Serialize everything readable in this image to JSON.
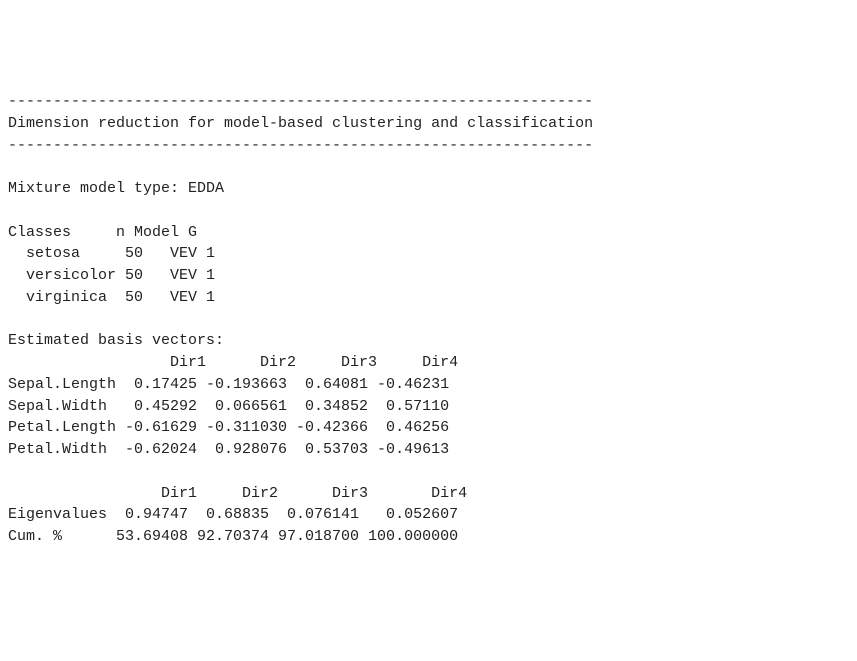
{
  "sep_line": "-----------------------------------------------------------------",
  "title": "Dimension reduction for model-based clustering and classification",
  "mixture_label": "Mixture model type:",
  "mixture_type": "EDDA",
  "classes_header": "Classes     n Model G",
  "classes": [
    {
      "name": "setosa",
      "n": 50,
      "model": "VEV",
      "g": 1
    },
    {
      "name": "versicolor",
      "n": 50,
      "model": "VEV",
      "g": 1
    },
    {
      "name": "virginica",
      "n": 50,
      "model": "VEV",
      "g": 1
    }
  ],
  "basis_label": "Estimated basis vectors:",
  "dir_header": "                  Dir1      Dir2     Dir3     Dir4",
  "basis": [
    {
      "var": "Sepal.Length",
      "d1": "0.17425",
      "d2": "-0.193663",
      "d3": "0.64081",
      "d4": "-0.46231"
    },
    {
      "var": "Sepal.Width",
      "d1": "0.45292",
      "d2": "0.066561",
      "d3": "0.34852",
      "d4": "0.57110"
    },
    {
      "var": "Petal.Length",
      "d1": "-0.61629",
      "d2": "-0.311030",
      "d3": "-0.42366",
      "d4": "0.46256"
    },
    {
      "var": "Petal.Width",
      "d1": "-0.62024",
      "d2": "0.928076",
      "d3": "0.53703",
      "d4": "-0.49613"
    }
  ],
  "stats_header": "                 Dir1     Dir2      Dir3       Dir4",
  "stats": [
    {
      "label": "Eigenvalues",
      "d1": "0.94747",
      "d2": "0.68835",
      "d3": "0.076141",
      "d4": "0.052607"
    },
    {
      "label": "Cum. %",
      "d1": "53.69408",
      "d2": "92.70374",
      "d3": "97.018700",
      "d4": "100.000000"
    }
  ],
  "chart_data": {
    "type": "table",
    "title": "Dimension reduction for model-based clustering and classification",
    "subtitle": "Mixture model type: EDDA",
    "classes_table": {
      "columns": [
        "Classes",
        "n",
        "Model",
        "G"
      ],
      "rows": [
        [
          "setosa",
          50,
          "VEV",
          1
        ],
        [
          "versicolor",
          50,
          "VEV",
          1
        ],
        [
          "virginica",
          50,
          "VEV",
          1
        ]
      ]
    },
    "basis_vectors": {
      "columns": [
        "",
        "Dir1",
        "Dir2",
        "Dir3",
        "Dir4"
      ],
      "rows": [
        [
          "Sepal.Length",
          0.17425,
          -0.193663,
          0.64081,
          -0.46231
        ],
        [
          "Sepal.Width",
          0.45292,
          0.066561,
          0.34852,
          0.5711
        ],
        [
          "Petal.Length",
          -0.61629,
          -0.31103,
          -0.42366,
          0.46256
        ],
        [
          "Petal.Width",
          -0.62024,
          0.928076,
          0.53703,
          -0.49613
        ]
      ]
    },
    "eigen_summary": {
      "columns": [
        "",
        "Dir1",
        "Dir2",
        "Dir3",
        "Dir4"
      ],
      "rows": [
        [
          "Eigenvalues",
          0.94747,
          0.68835,
          0.076141,
          0.052607
        ],
        [
          "Cum. %",
          53.69408,
          92.70374,
          97.0187,
          100.0
        ]
      ]
    }
  }
}
